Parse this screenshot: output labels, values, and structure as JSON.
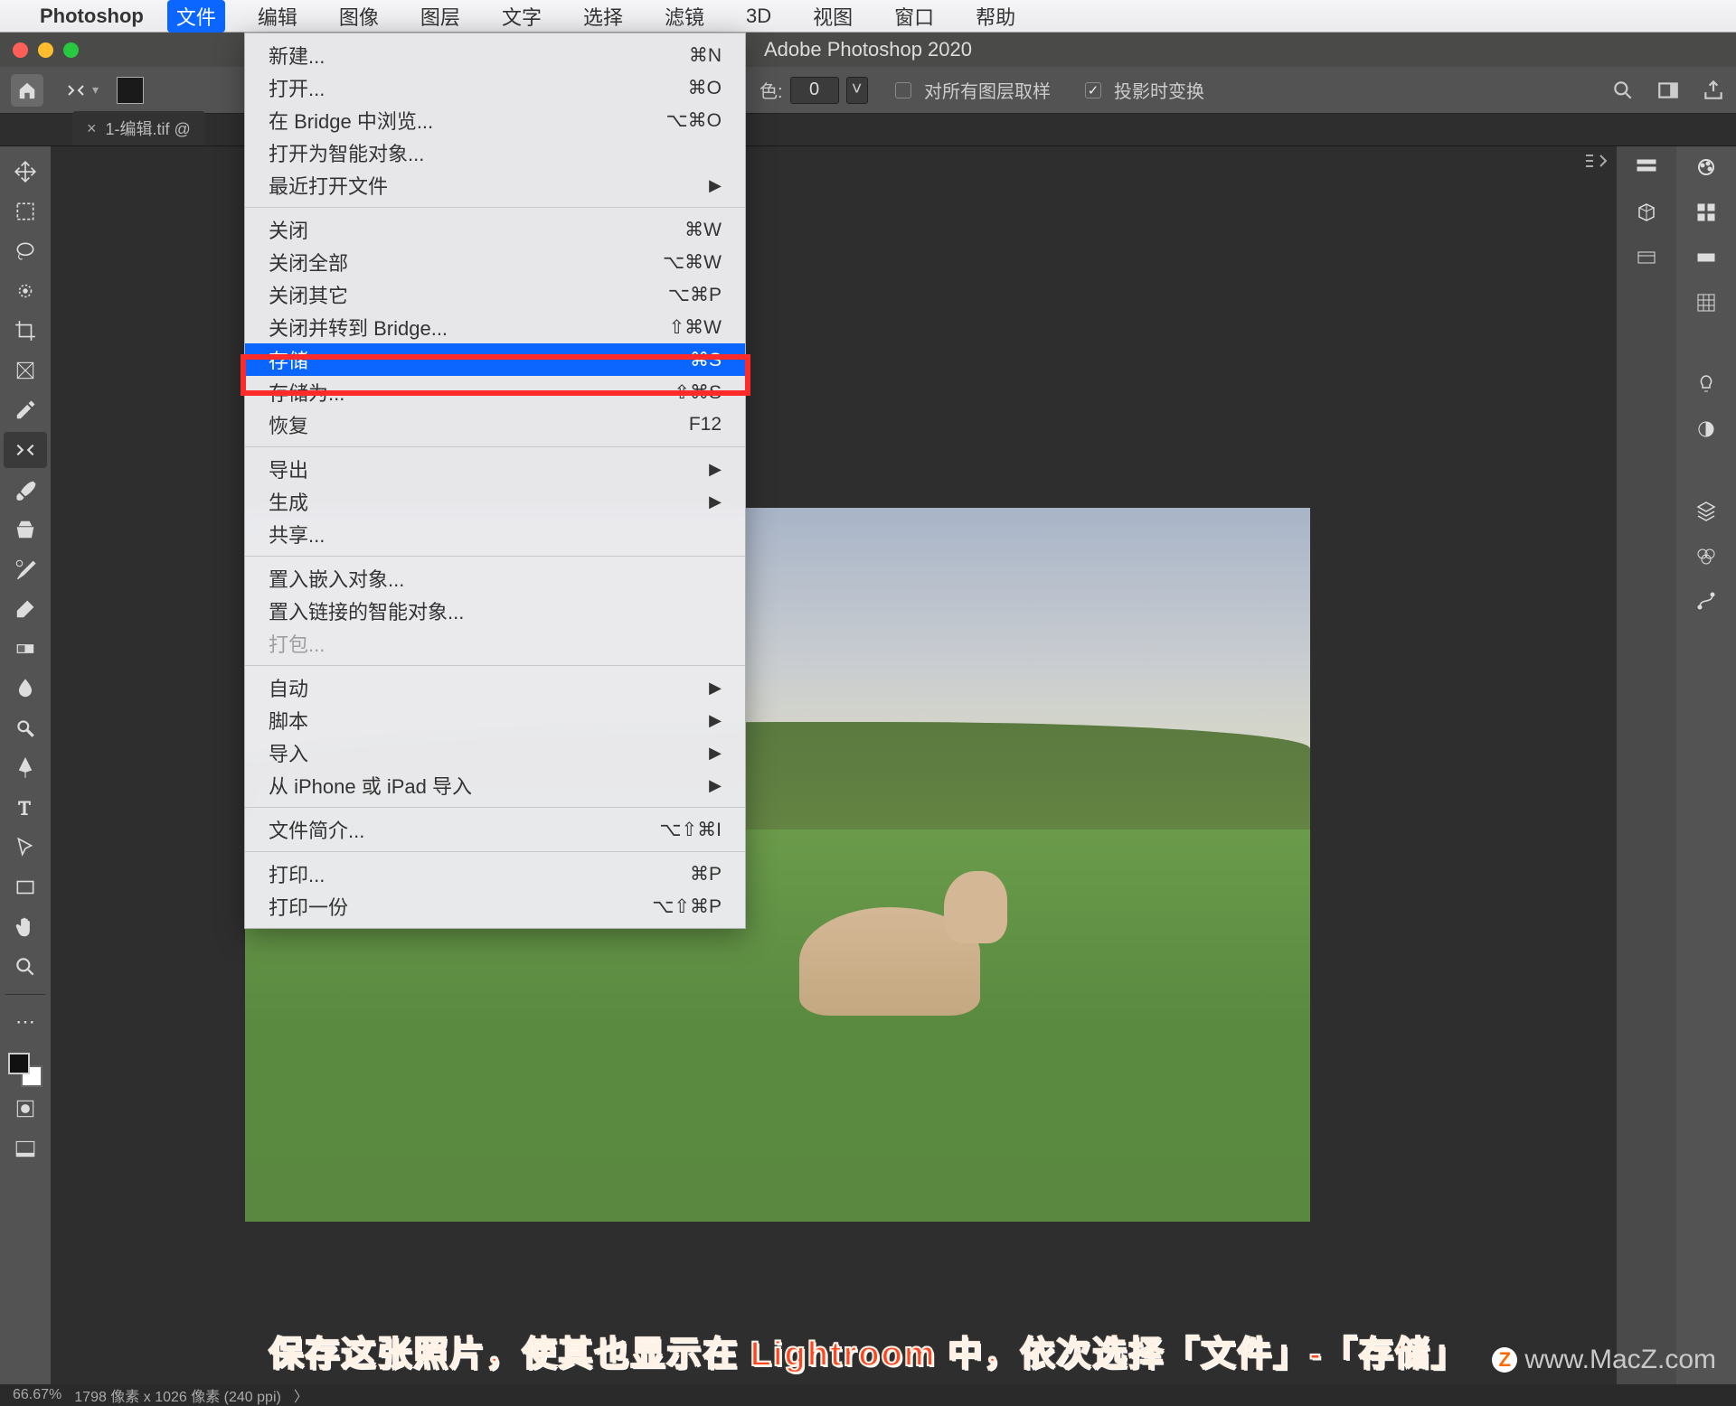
{
  "menubar": {
    "app": "Photoshop",
    "items": [
      "文件",
      "编辑",
      "图像",
      "图层",
      "文字",
      "选择",
      "滤镜",
      "3D",
      "视图",
      "窗口",
      "帮助"
    ],
    "active_index": 0
  },
  "window": {
    "title": "Adobe Photoshop 2020"
  },
  "options_bar": {
    "label_color": "色:",
    "value": "0",
    "cb1_label": "对所有图层取样",
    "cb2_label": "投影时变换"
  },
  "doc_tab": {
    "label": "1-编辑.tif @"
  },
  "file_menu": {
    "groups": [
      [
        {
          "label": "新建...",
          "shortcut": "⌘N"
        },
        {
          "label": "打开...",
          "shortcut": "⌘O"
        },
        {
          "label": "在 Bridge 中浏览...",
          "shortcut": "⌥⌘O"
        },
        {
          "label": "打开为智能对象..."
        },
        {
          "label": "最近打开文件",
          "submenu": true
        }
      ],
      [
        {
          "label": "关闭",
          "shortcut": "⌘W"
        },
        {
          "label": "关闭全部",
          "shortcut": "⌥⌘W"
        },
        {
          "label": "关闭其它",
          "shortcut": "⌥⌘P"
        },
        {
          "label": "关闭并转到 Bridge...",
          "shortcut": "⇧⌘W"
        },
        {
          "label": "存储",
          "shortcut": "⌘S",
          "highlight": true
        },
        {
          "label": "存储为...",
          "shortcut": "⇧⌘S"
        },
        {
          "label": "恢复",
          "shortcut": "F12"
        }
      ],
      [
        {
          "label": "导出",
          "submenu": true
        },
        {
          "label": "生成",
          "submenu": true
        },
        {
          "label": "共享..."
        }
      ],
      [
        {
          "label": "置入嵌入对象..."
        },
        {
          "label": "置入链接的智能对象..."
        },
        {
          "label": "打包...",
          "disabled": true
        }
      ],
      [
        {
          "label": "自动",
          "submenu": true
        },
        {
          "label": "脚本",
          "submenu": true
        },
        {
          "label": "导入",
          "submenu": true
        },
        {
          "label": "从 iPhone 或 iPad 导入",
          "submenu": true
        }
      ],
      [
        {
          "label": "文件简介...",
          "shortcut": "⌥⇧⌘I"
        }
      ],
      [
        {
          "label": "打印...",
          "shortcut": "⌘P"
        },
        {
          "label": "打印一份",
          "shortcut": "⌥⇧⌘P"
        }
      ]
    ]
  },
  "right_panel_icons_a": [
    "history-icon",
    "3d-icon",
    "sources-icon"
  ],
  "right_panel_icons_b": [
    "color-icon",
    "swatches-icon",
    "gradients-icon",
    "patterns-icon",
    "light-icon",
    "adjust-icon",
    "layers-icon",
    "channels-icon",
    "paths-icon"
  ],
  "status": {
    "zoom": "66.67%",
    "info": "1798 像素 x 1026 像素 (240 ppi)",
    "arrow": "〉"
  },
  "caption": "保存这张照片，使其也显示在 Lightroom 中，依次选择「文件」-「存储」",
  "watermark": "www.MacZ.com"
}
